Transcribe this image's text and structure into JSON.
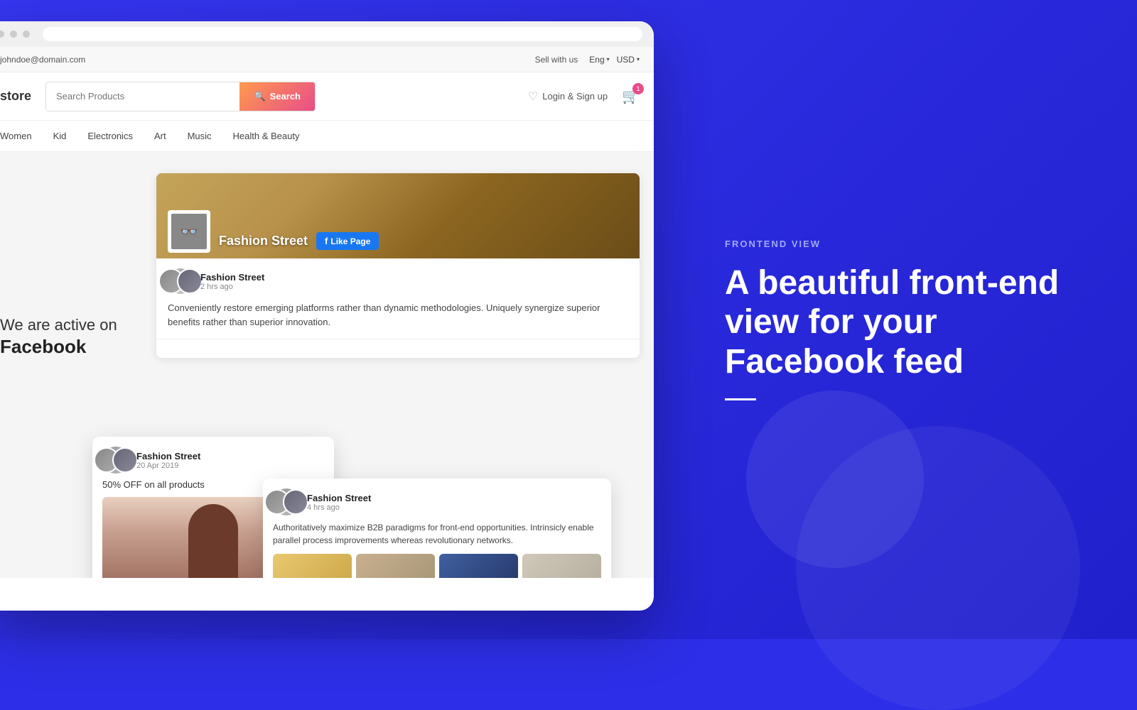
{
  "page": {
    "bg_color": "#2d2fe8"
  },
  "topbar": {
    "email": "johndoe@domain.com",
    "sell_link": "Sell with us",
    "lang": "Eng",
    "currency": "USD"
  },
  "header": {
    "store_name": "store",
    "search_placeholder": "Search Products",
    "search_btn_label": "Search",
    "login_label": "Login & Sign up",
    "cart_badge": "1"
  },
  "nav": {
    "items": [
      "Women",
      "Kid",
      "Electronics",
      "Art",
      "Music",
      "Health & Beauty"
    ]
  },
  "facebook_section": {
    "we_are_active": "We are active on",
    "facebook": "Facebook",
    "page_name": "Fashion Street",
    "like_btn": "Like Page",
    "post1": {
      "name": "Fashion Street",
      "time": "2 hrs ago",
      "text": "Conveniently restore emerging platforms rather than dynamic methodologies. Uniquely synergize superior benefits rather than superior innovation."
    },
    "float_card1": {
      "name": "Fashion Street",
      "time": "20 Apr 2019",
      "discount_text": "50% OFF on all products"
    },
    "float_card2": {
      "name": "Fashion Street",
      "time": "4 hrs ago",
      "text": "Authoritatively maximize B2B paradigms for front-end opportunities. Intrinsicly enable parallel process improvements whereas revolutionary networks."
    }
  },
  "right_panel": {
    "label": "FRONTEND VIEW",
    "heading": "A beautiful front-end view for your Facebook feed"
  }
}
